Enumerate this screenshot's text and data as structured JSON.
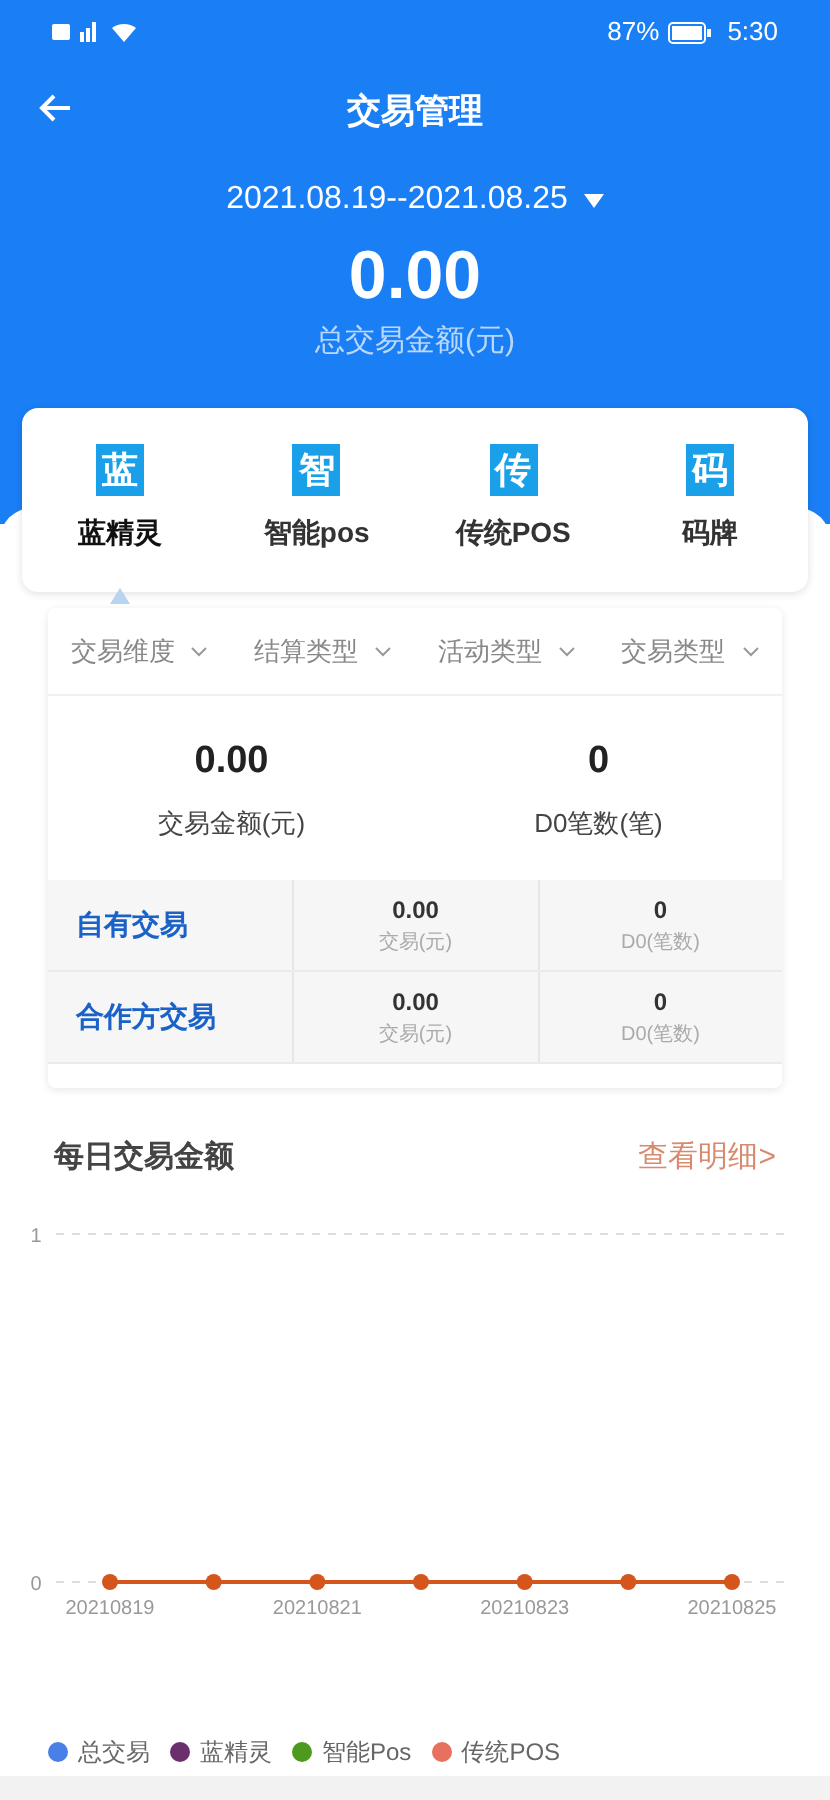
{
  "status_bar": {
    "battery": "87%",
    "time": "5:30"
  },
  "header": {
    "title": "交易管理",
    "date_range": "2021.08.19--2021.08.25",
    "total": "0.00",
    "total_label": "总交易金额(元)"
  },
  "product_tabs": [
    {
      "icon_char": "蓝",
      "label": "蓝精灵",
      "selected": true
    },
    {
      "icon_char": "智",
      "label": "智能pos",
      "selected": false
    },
    {
      "icon_char": "传",
      "label": "传统POS",
      "selected": false
    },
    {
      "icon_char": "码",
      "label": "码牌",
      "selected": false
    }
  ],
  "filters": [
    "交易维度",
    "结算类型",
    "活动类型",
    "交易类型"
  ],
  "summary": [
    {
      "value": "0.00",
      "label": "交易金额(元)"
    },
    {
      "value": "0",
      "label": "D0笔数(笔)"
    }
  ],
  "breakdown": [
    {
      "name": "自有交易",
      "cells": [
        {
          "value": "0.00",
          "label": "交易(元)"
        },
        {
          "value": "0",
          "label": "D0(笔数)"
        }
      ]
    },
    {
      "name": "合作方交易",
      "cells": [
        {
          "value": "0.00",
          "label": "交易(元)"
        },
        {
          "value": "0",
          "label": "D0(笔数)"
        }
      ]
    }
  ],
  "daily": {
    "title": "每日交易金额",
    "link": "查看明细>",
    "chart_data": {
      "type": "line",
      "categories": [
        "20210819",
        null,
        "20210821",
        null,
        "20210823",
        null,
        "20210825"
      ],
      "yticks": [
        0,
        1
      ],
      "ylim": [
        0,
        1
      ],
      "series": [
        {
          "color": "#d4561c",
          "marker": "circle",
          "values": [
            0,
            0,
            0,
            0,
            0,
            0,
            0
          ]
        }
      ]
    },
    "legend_items": [
      {
        "name": "总交易",
        "color": "#4a7fe8"
      },
      {
        "name": "蓝精灵",
        "color": "#6b2f6b"
      },
      {
        "name": "智能Pos",
        "color": "#4e9a1e"
      },
      {
        "name": "传统POS",
        "color": "#e8705f"
      }
    ]
  }
}
